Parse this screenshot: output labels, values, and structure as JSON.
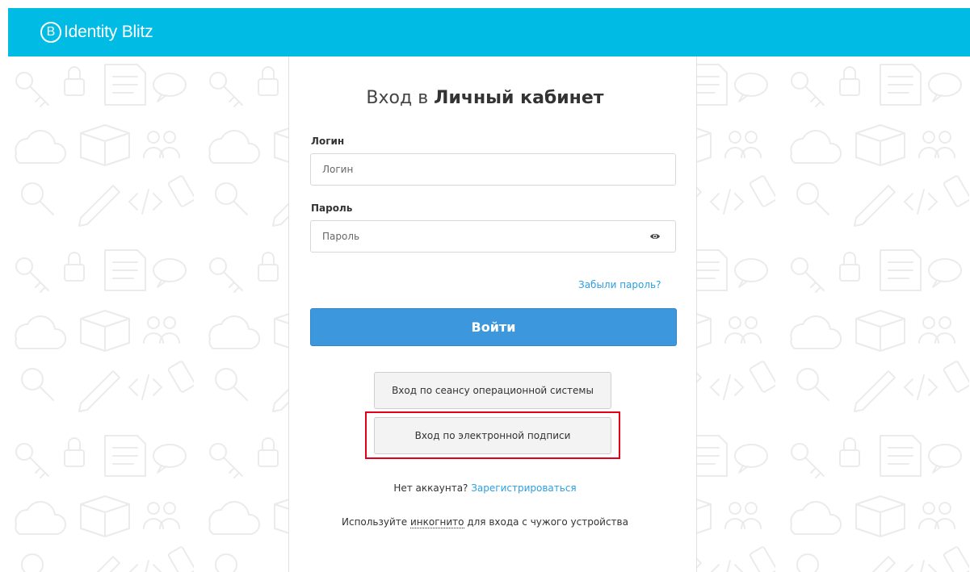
{
  "brand": {
    "name": "Identity Blitz",
    "mark": "B",
    "bar_color": "#00bce4"
  },
  "form": {
    "title_prefix": "Вход в ",
    "title_bold": "Личный кабинет",
    "login_label": "Логин",
    "login_placeholder": "Логин",
    "password_label": "Пароль",
    "password_placeholder": "Пароль",
    "forgot_link": "Забыли пароль?",
    "submit_label": "Войти",
    "os_session_button": "Вход по сеансу операционной системы",
    "signature_button": "Вход по электронной подписи",
    "no_account": "Нет аккаунта? ",
    "register_link": "Зарегистрироваться",
    "incognito_prefix": "Используйте ",
    "incognito_word": "инкогнито",
    "incognito_suffix": " для входа с чужого устройства"
  },
  "colors": {
    "accent": "#3d97dc",
    "link": "#2d9ee0",
    "highlight": "#e3001b"
  },
  "icons": {
    "password_toggle": "eye-icon"
  }
}
